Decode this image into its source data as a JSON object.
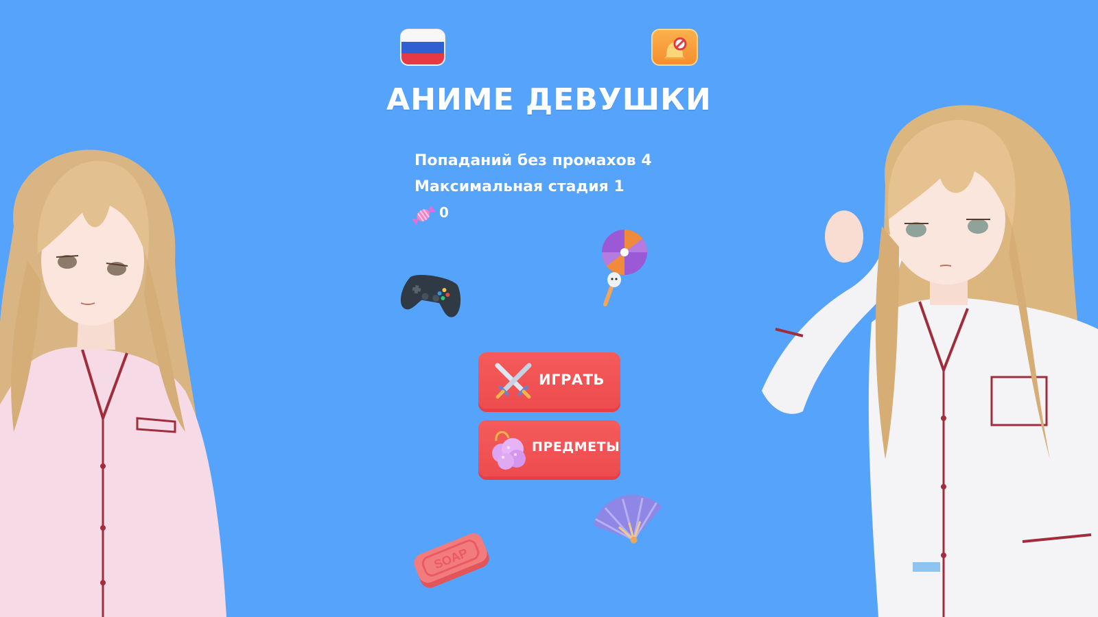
{
  "title": "АНИМЕ ДЕВУШКИ",
  "stats": {
    "streak_label": "Попаданий без промахов 4",
    "stage_label": "Максимальная стадия 1",
    "candy_count": "0"
  },
  "buttons": {
    "play_label": "ИГРАТЬ",
    "items_label": "ПРЕДМЕТЫ"
  },
  "icons": {
    "language": "russia-flag-icon",
    "ads": "no-ads-bell-icon",
    "candy": "candy-icon",
    "play": "crossed-swords-icon",
    "items": "sponge-icon"
  },
  "decorations": [
    "gamepad-icon",
    "lollipop-icon",
    "hand-fan-icon",
    "soap-icon",
    "anime-girl-left",
    "anime-girl-right"
  ],
  "colors": {
    "background": "#56a3fb",
    "button": "#f0514f",
    "ads_button": "#f99a3a"
  },
  "soap_text": "SOAP"
}
